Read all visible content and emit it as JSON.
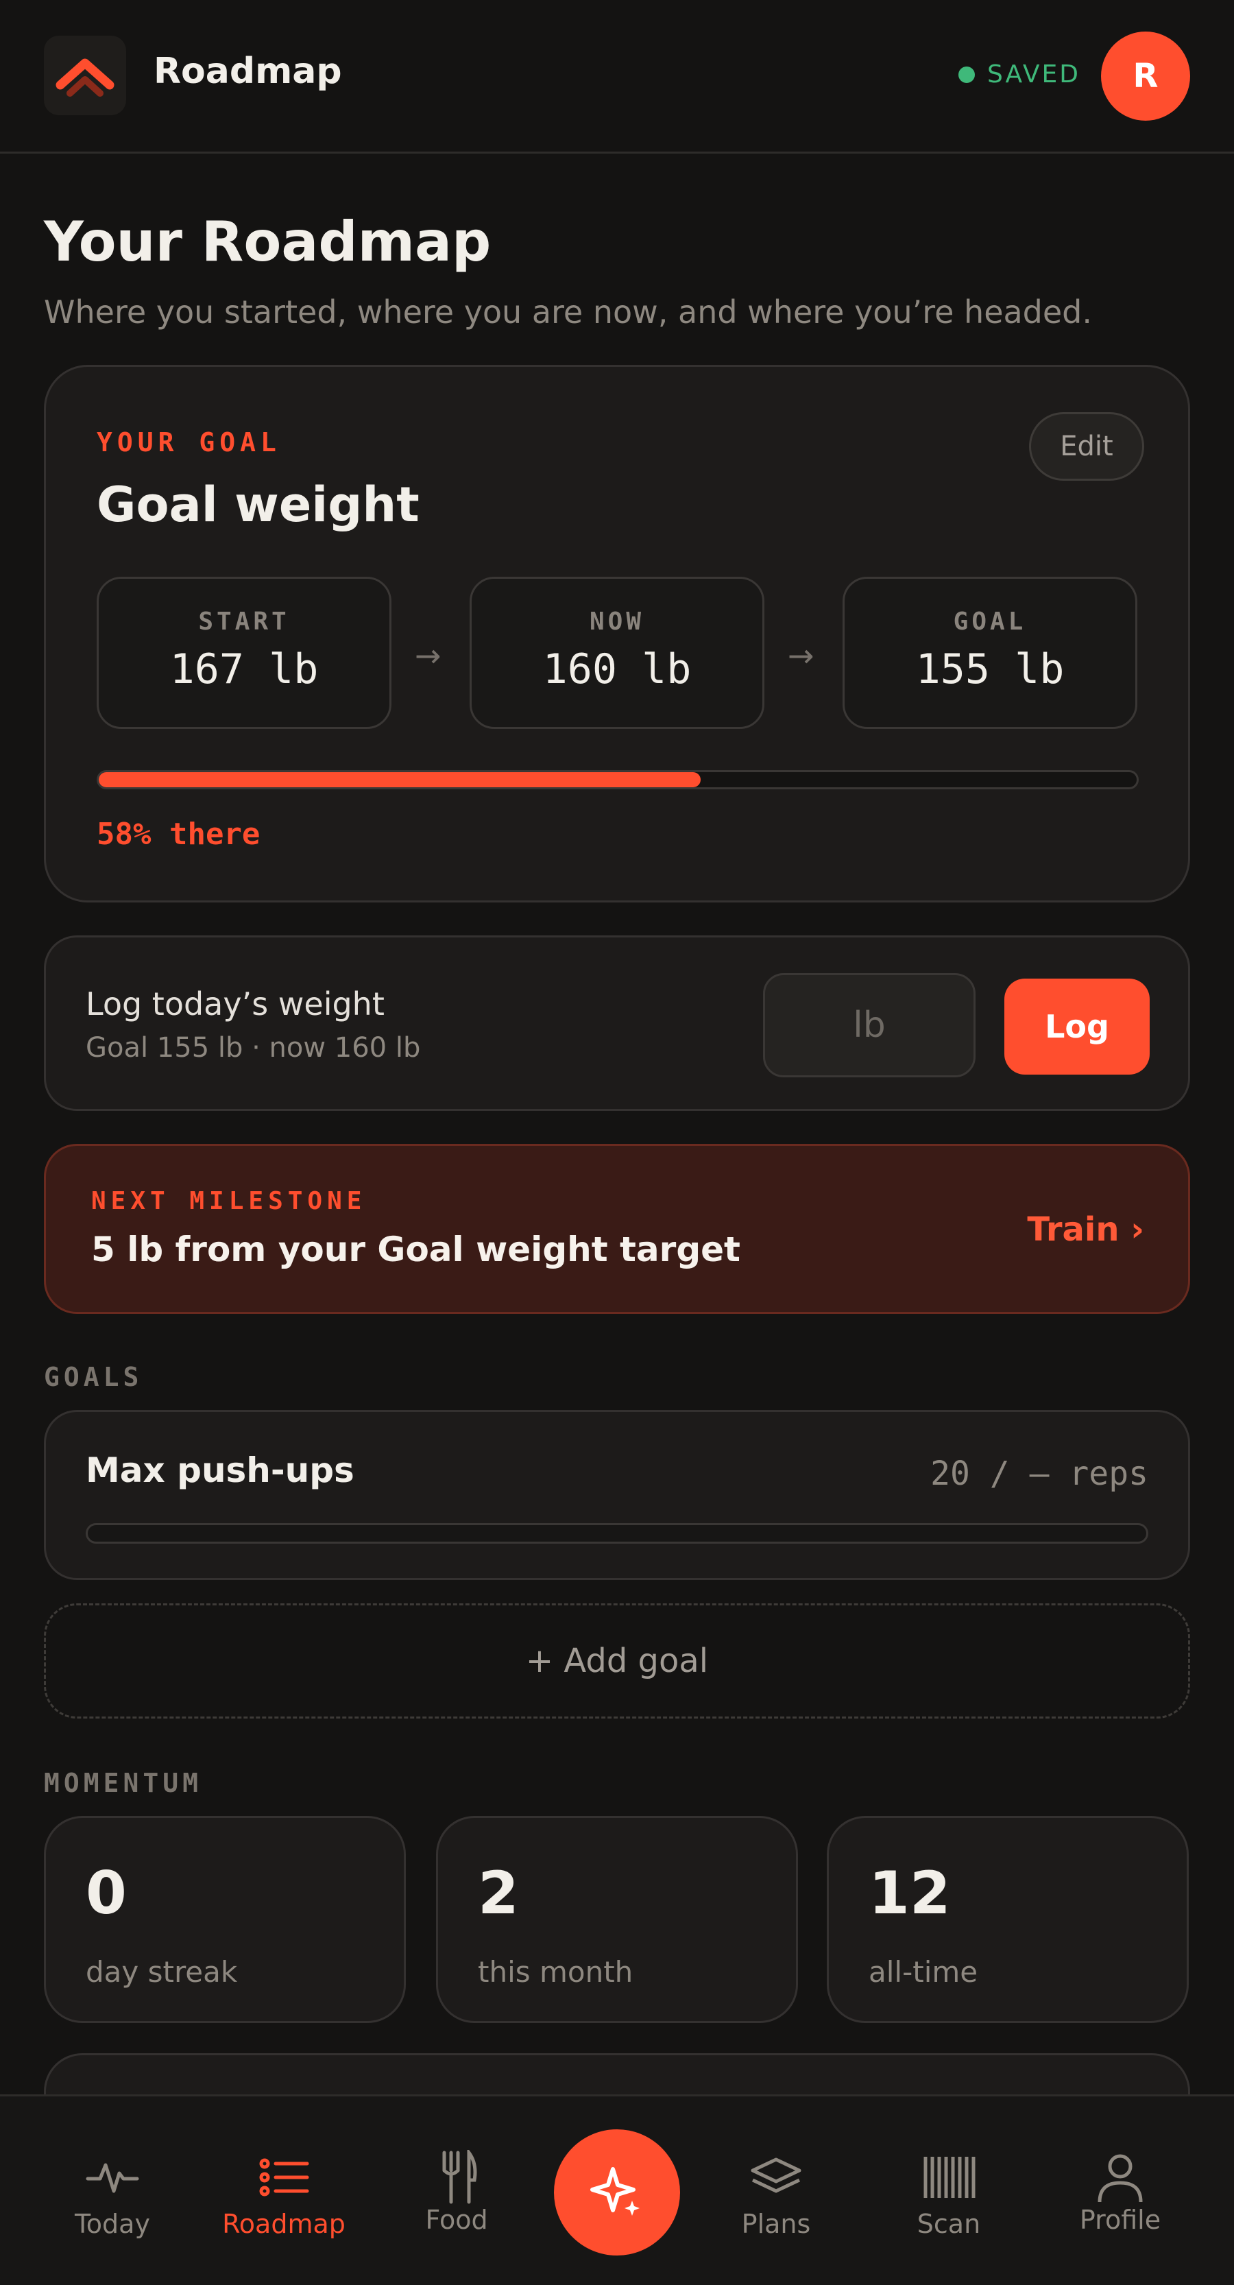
{
  "header": {
    "app_title": "Roadmap",
    "saved_status": "SAVED",
    "avatar_initial": "R"
  },
  "page": {
    "title": "Your Roadmap",
    "subtitle": "Where you started, where you are now, and where you’re headed."
  },
  "goal_card": {
    "eyebrow": "YOUR GOAL",
    "title": "Goal weight",
    "edit_label": "Edit",
    "start_label": "START",
    "start_value": "167 lb",
    "now_label": "NOW",
    "now_value": "160 lb",
    "goal_label": "GOAL",
    "goal_value": "155 lb",
    "progress_percent": 58,
    "progress_text": "58% there"
  },
  "log_weight": {
    "title": "Log today’s weight",
    "subtitle": "Goal 155 lb · now 160 lb",
    "input_placeholder": "lb",
    "button_label": "Log"
  },
  "milestone": {
    "eyebrow": "NEXT MILESTONE",
    "title": "5 lb from your Goal weight target",
    "link_label": "Train ›"
  },
  "goals_section": {
    "label": "GOALS",
    "items": [
      {
        "title": "Max push-ups",
        "value": "20 / — reps",
        "progress_percent": 0
      }
    ],
    "add_label": "+ Add goal"
  },
  "momentum_section": {
    "label": "MOMENTUM",
    "cards": [
      {
        "value": "0",
        "label": "day streak"
      },
      {
        "value": "2",
        "label": "this month"
      },
      {
        "value": "12",
        "label": "all-time"
      }
    ]
  },
  "nav": {
    "items": [
      {
        "label": "Today",
        "icon": "pulse-icon"
      },
      {
        "label": "Roadmap",
        "icon": "list-icon",
        "active": true
      },
      {
        "label": "Food",
        "icon": "fork-knife-icon"
      },
      {
        "label": "Plans",
        "icon": "layers-icon"
      },
      {
        "label": "Scan",
        "icon": "barcode-icon"
      },
      {
        "label": "Profile",
        "icon": "user-icon"
      }
    ],
    "center_icon": "sparkle-icon"
  },
  "colors": {
    "accent": "#ff4e2e",
    "saved_green": "#3fb97a",
    "background": "#141312",
    "card": "#1d1b1a",
    "milestone_bg": "#3a1b16"
  }
}
